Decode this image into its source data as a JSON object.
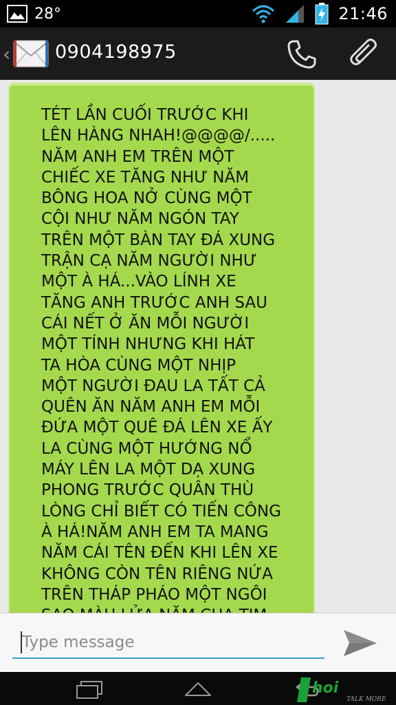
{
  "status_bar": {
    "temperature": "28°",
    "time": "21:46",
    "icons": [
      "gallery-notification-icon",
      "wifi-icon",
      "signal-icon",
      "battery-charging-icon"
    ]
  },
  "action_bar": {
    "contact": "0904198975",
    "icons": [
      "back-chevron-icon",
      "envelope-icon",
      "phone-icon",
      "paperclip-icon"
    ]
  },
  "conversation": {
    "messages": [
      {
        "text": "TÉT LẦN CUỐI TRƯỚC KHI\nLÊN HÀNG NHAH!@@@@/.....\nNĂM ANH EM TRÊN MỘT\nCHIẾC XE TĂNG NHƯ NĂM\nBÔNG HOA NỞ CÙNG MỘT\nCỘI NHƯ NĂM NGÓN TAY\nTRÊN MỘT BÀN TAY ĐÁ XUNG\nTRẬN CẠ NĂM NGƯỜI NHƯ\nMỘT À HÁ...VÀO LÍNH XE\nTĂNG ANH TRƯỚC ANH SAU\nCÁI NẾT Ở ĂN MỖI NGƯỜI\nMỘT TÍNH NHƯNG KHI HÁT\nTA HÒA CÙNG MỘT NHỊP\nMỘT NGƯỜI ĐAU LA TẤT CẢ\nQUÊN ĂN NĂM ANH EM MỖI\nĐỨA MỘT QUÊ ĐÁ LÊN XE ẤY\nLA CÙNG MỘT HƯỚNG NỔ\nMÁY LÊN LA MỘT DẠ XUNG\nPHONG TRƯỚC QUÂN THÙ\nLÒNG CHỈ BIẾT CÓ TIẾN CÔNG\nÀ HÁ!NĂM ANH EM TA MANG\nNĂM CÁI TÊN ĐẾN KHI LÊN XE\nKHÔNG CÒN TÊN RIÊNG NỨA\nTRÊN THÁP PHÁO MỘT NGÔI\nSAO MÀU LỬA NĂM CHA TIM",
        "bubble_color": "#a4d94d"
      }
    ]
  },
  "composer": {
    "placeholder": "Type message",
    "value": "",
    "send_icon": "send-arrow-icon",
    "accent": "#2f9fd0"
  },
  "nav_bar": {
    "icons": [
      "recent-apps-icon",
      "home-icon",
      "back-icon"
    ]
  },
  "watermark": {
    "brand_text": "hoi",
    "slogan": "TALK MORE"
  }
}
